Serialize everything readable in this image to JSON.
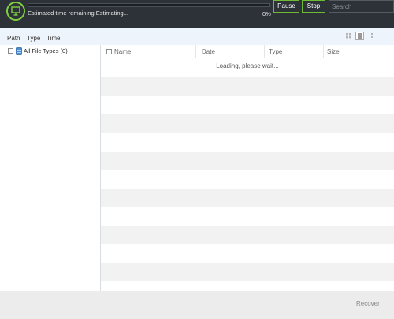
{
  "colors": {
    "accent": "#7fcf3f",
    "topbar_bg": "#2d3238",
    "tab_strip_bg": "#eef4fb",
    "row_stripe": "#f2f2f2"
  },
  "header": {
    "logo_icon": "monitor-icon",
    "progress_percent": 0,
    "estimated_label": "Estimated time remaining:Estimating...",
    "progress_text": "0%",
    "pause_label": "Pause",
    "stop_label": "Stop",
    "search_placeholder": "Search"
  },
  "tabs": {
    "items": [
      {
        "label": "Path"
      },
      {
        "label": "Type",
        "selected": true
      },
      {
        "label": "Time"
      }
    ],
    "view_icons": [
      "grid-view-icon",
      "list-view-icon",
      "detail-view-icon"
    ]
  },
  "tree": {
    "root_label": "All File Types (0)",
    "root_icon": "database-icon"
  },
  "file_list": {
    "columns": [
      "Name",
      "Date",
      "Type",
      "Size"
    ],
    "loading_text": "Loading, please wait...",
    "rows": []
  },
  "footer": {
    "button_label": "Recover"
  }
}
